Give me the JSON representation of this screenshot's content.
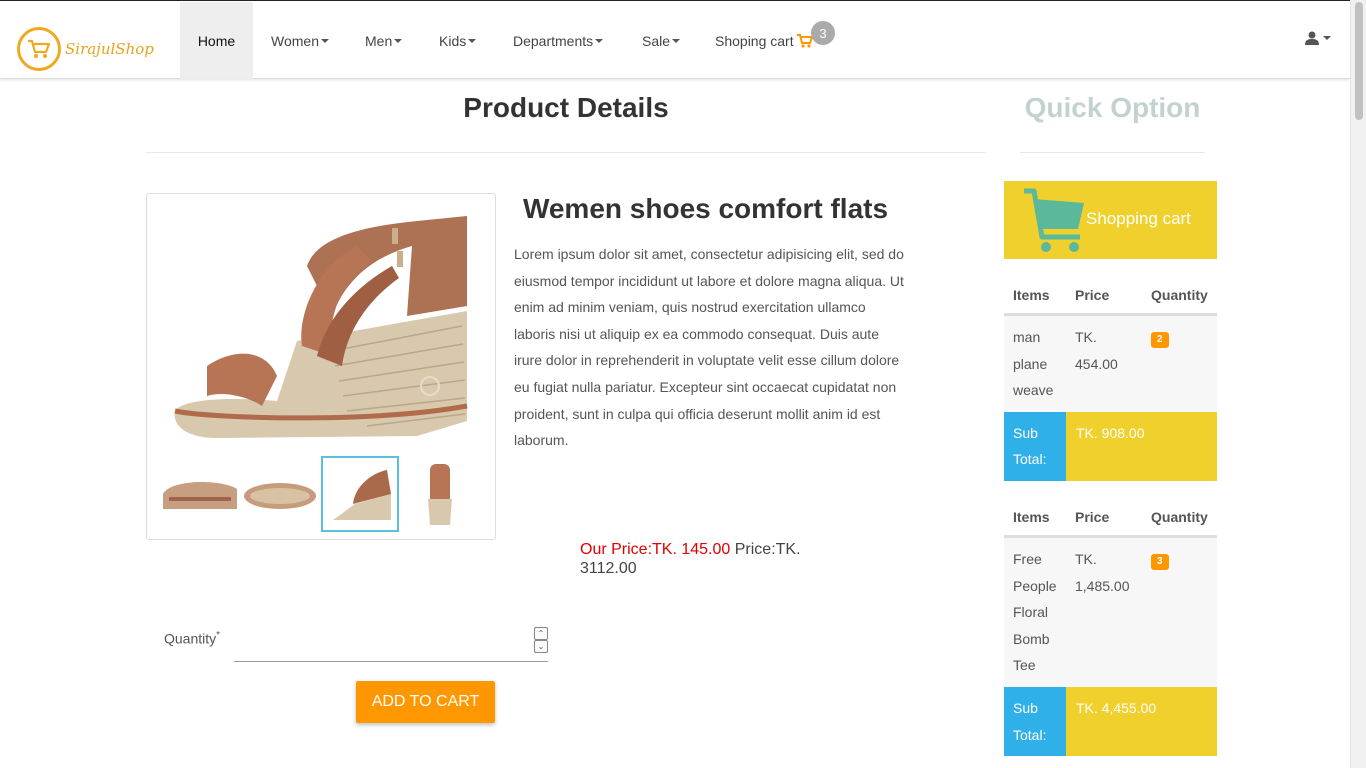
{
  "brand": {
    "name": "SirajulShop",
    "accent": "#f0a81f"
  },
  "nav": {
    "home": "Home",
    "women": "Women",
    "men": "Men",
    "kids": "Kids",
    "departments": "Departments",
    "sale": "Sale",
    "cart": "Shoping cart",
    "cart_count": "3"
  },
  "page": {
    "title": "Product Details",
    "quick_title": "Quick Option"
  },
  "product": {
    "name": "Wemen shoes comfort flats",
    "description": "Lorem ipsum dolor sit amet, consectetur adipisicing elit, sed do eiusmod tempor incididunt ut labore et dolore magna aliqua. Ut enim ad minim veniam, quis nostrud exercitation ullamco laboris nisi ut aliquip ex ea commodo consequat. Duis aute irure dolor in reprehenderit in voluptate velit esse cillum dolore eu fugiat nulla pariatur. Excepteur sint occaecat cupidatat non proident, sunt in culpa qui officia deserunt mollit anim id est laborum.",
    "our_price": "Our Price:TK. 145.00",
    "price": "Price:TK. 3112.00",
    "selected_thumbnail": 3
  },
  "form": {
    "quantity_label": "Quantity",
    "required_mark": "*",
    "quantity_value": "",
    "add_to_cart": "ADD TO CART"
  },
  "quick": {
    "cart_title": "Shopping cart",
    "headers": {
      "items": "Items",
      "price": "Price",
      "quantity": "Quantity"
    },
    "entries": [
      {
        "item": "man plane weave",
        "price": "TK. 454.00",
        "qty": "2",
        "subtotal_label": "Sub Total:",
        "subtotal": "TK. 908.00"
      },
      {
        "item": "Free People Floral Bomb Tee",
        "price": "TK. 1,485.00",
        "qty": "3",
        "subtotal_label": "Sub Total:",
        "subtotal": "TK. 4,455.00"
      }
    ]
  },
  "colors": {
    "accent_orange": "#ff9800",
    "sub_blue": "#30b0e8",
    "sub_yellow": "#f0d02c",
    "our_price_red": "#e00000"
  }
}
